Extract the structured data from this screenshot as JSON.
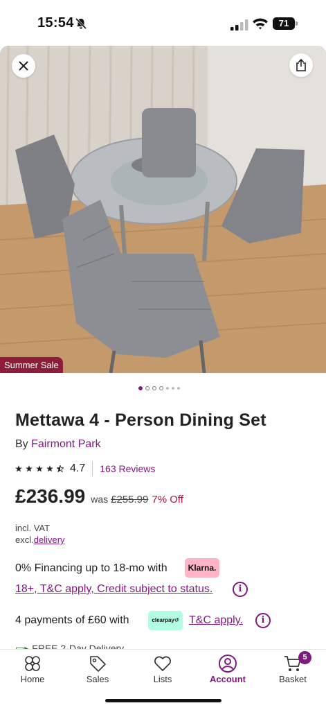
{
  "status_bar": {
    "time": "15:54",
    "battery": "71"
  },
  "hero": {
    "badge": "Summer Sale",
    "pager": {
      "total": 7,
      "active_index": 0
    }
  },
  "product": {
    "title": "Mettawa 4 - Person Dining Set",
    "by_prefix": "By",
    "brand": "Fairmont Park",
    "rating": "4.7",
    "reviews": "163 Reviews",
    "price": "£236.99",
    "was_label": "was",
    "old_price": "£255.99",
    "discount": "7% Off",
    "vat_note": "incl. VAT",
    "delivery_prefix": "excl.",
    "delivery_link": "delivery"
  },
  "financing": {
    "text": "0% Financing up to 18-mo with",
    "provider": "Klarna.",
    "terms": "18+, T&C apply, Credit subject to status.",
    "installments_text": "4 payments of £60 with",
    "installments_provider": "clearpay",
    "installments_terms": "T&C apply."
  },
  "free_delivery": "FREE 2-Day Delivery",
  "nav": {
    "items": [
      {
        "label": "Home"
      },
      {
        "label": "Sales"
      },
      {
        "label": "Lists"
      },
      {
        "label": "Account"
      },
      {
        "label": "Basket"
      }
    ],
    "active": "Account",
    "basket_count": "5"
  },
  "colors": {
    "brand": "#7f187f",
    "sale": "#8e1d3b",
    "discount": "#b0133a",
    "klarna": "#ffb3c7",
    "clearpay": "#b2fce4"
  }
}
